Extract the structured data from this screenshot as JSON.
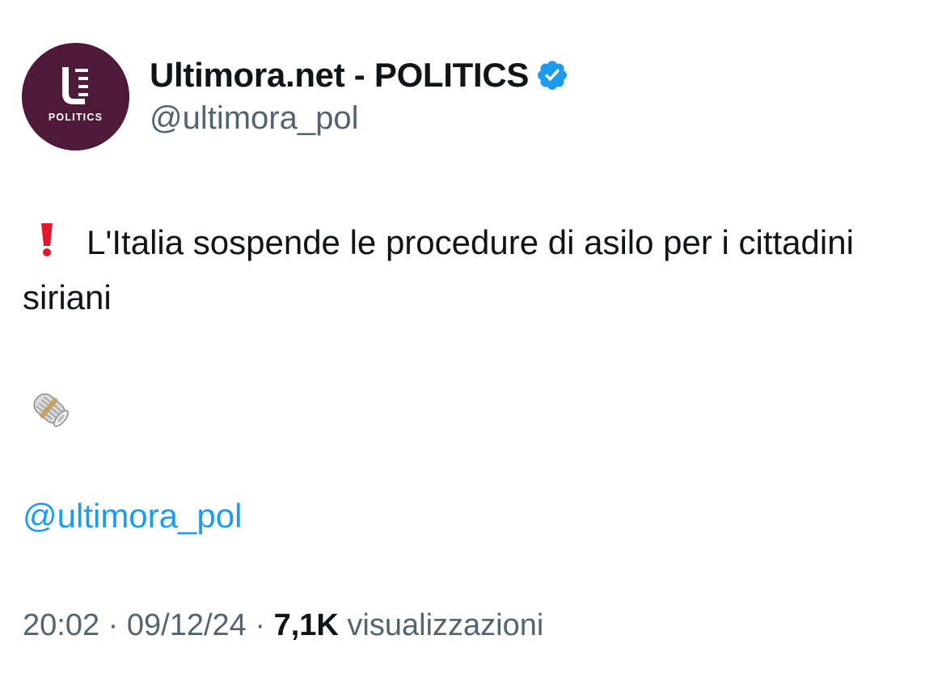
{
  "account": {
    "avatar_label": "POLITICS",
    "display_name": "Ultimora.net - POLITICS",
    "handle": "@ultimora_pol",
    "verified_icon": "verified-badge-icon",
    "accent_color": "#1d9bf0",
    "avatar_color": "#4f1a3a"
  },
  "tweet": {
    "leading_icon": "red-exclamation-icon",
    "text": "L'Italia sospende le procedure di asilo per i cittadini siriani",
    "media_icon": "rolled-newspaper-icon",
    "mention": "@ultimora_pol"
  },
  "meta": {
    "time": "20:02",
    "separator": " · ",
    "date": "09/12/24",
    "views_count": "7,1K",
    "views_label": "visualizzazioni"
  }
}
